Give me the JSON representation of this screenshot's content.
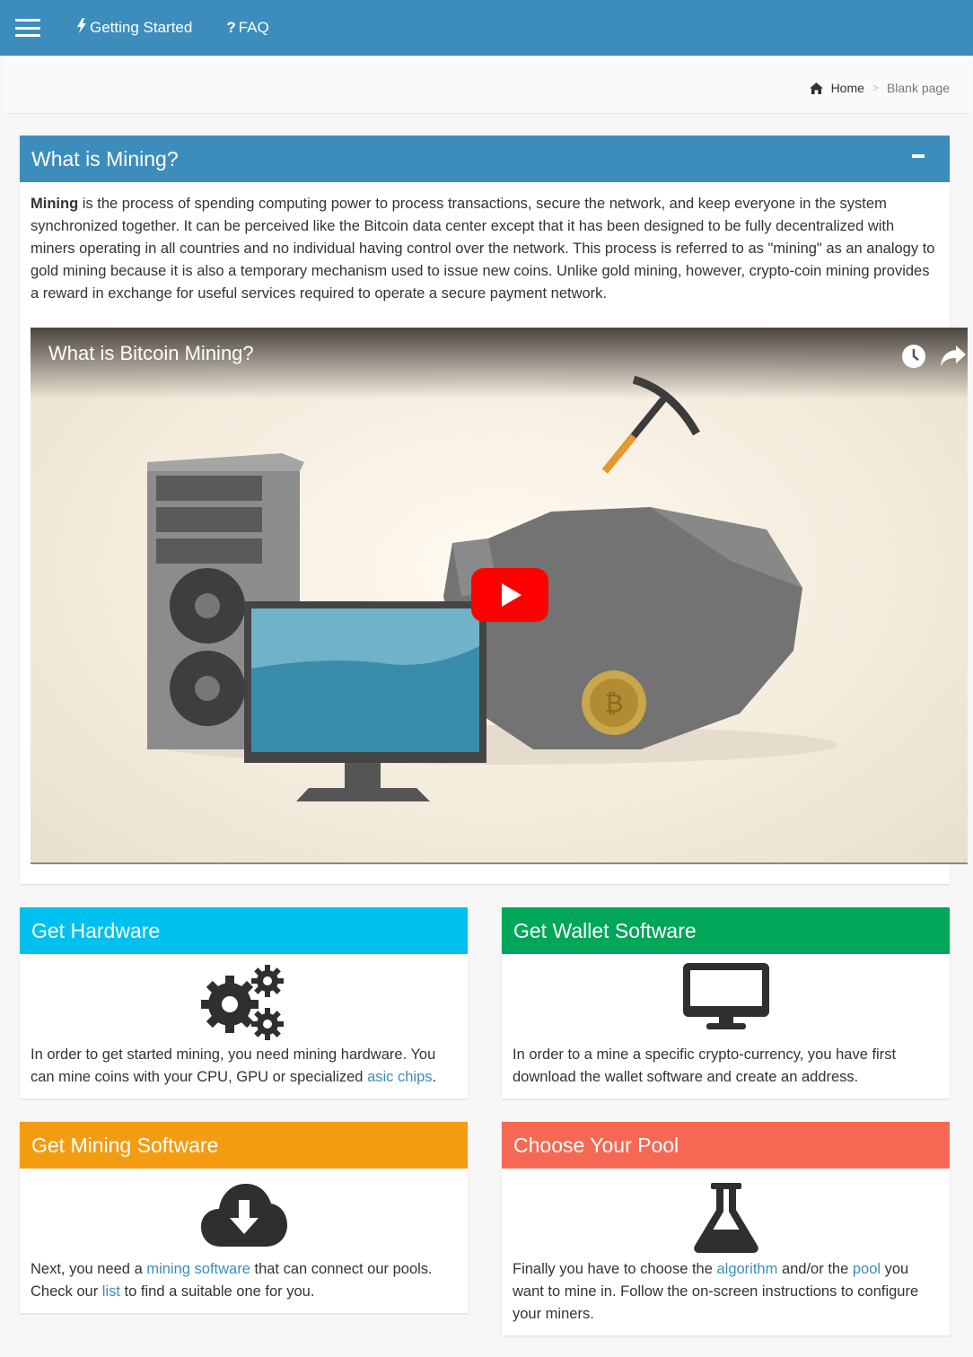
{
  "nav": {
    "getting_started": "Getting Started",
    "faq": "FAQ"
  },
  "breadcrumb": {
    "home": "Home",
    "separator": ">",
    "current": "Blank page"
  },
  "mining_box": {
    "title": "What is Mining?",
    "bold_word": "Mining",
    "text": " is the process of spending computing power to process transactions, secure the network, and keep everyone in the system synchronized together. It can be perceived like the Bitcoin data center except that it has been designed to be fully decentralized with miners operating in all countries and no individual having control over the network. This process is referred to as \"mining\" as an analogy to gold mining because it is also a temporary mechanism used to issue new coins. Unlike gold mining, however, crypto-coin mining provides a reward in exchange for useful services required to operate a secure payment network."
  },
  "video": {
    "title": "What is Bitcoin Mining?",
    "icons": [
      "watch-later-icon",
      "share-icon",
      "play-icon"
    ]
  },
  "cards": {
    "hardware": {
      "title": "Get Hardware",
      "color": "#00c0ef",
      "icon": "gears-icon",
      "text_a": "In order to get started mining, you need mining hardware. You can mine coins with your CPU, GPU or specialized ",
      "link": "asic chips",
      "text_b": "."
    },
    "wallet": {
      "title": "Get Wallet Software",
      "color": "#00a65a",
      "icon": "desktop-icon",
      "text": "In order to a mine a specific crypto-currency, you have first download the wallet software and create an address."
    },
    "software": {
      "title": "Get Mining Software",
      "color": "#f39c12",
      "icon": "cloud-download-icon",
      "text_a": "Next, you need a ",
      "link_a": "mining software",
      "text_b": " that can connect our pools. Check our ",
      "link_b": "list",
      "text_c": " to find a suitable one for you."
    },
    "pool": {
      "title": "Choose Your Pool",
      "color": "#f56954",
      "icon": "flask-icon",
      "text_a": "Finally you have to choose the ",
      "link_a": "algorithm",
      "text_b": " and/or the ",
      "link_b": "pool",
      "text_c": " you want to mine in. Follow the on-screen instructions to configure your miners."
    }
  },
  "colors": {
    "primary": "#3c8dbc",
    "link": "#3c8dbc",
    "youtube_red": "#ff0000"
  }
}
